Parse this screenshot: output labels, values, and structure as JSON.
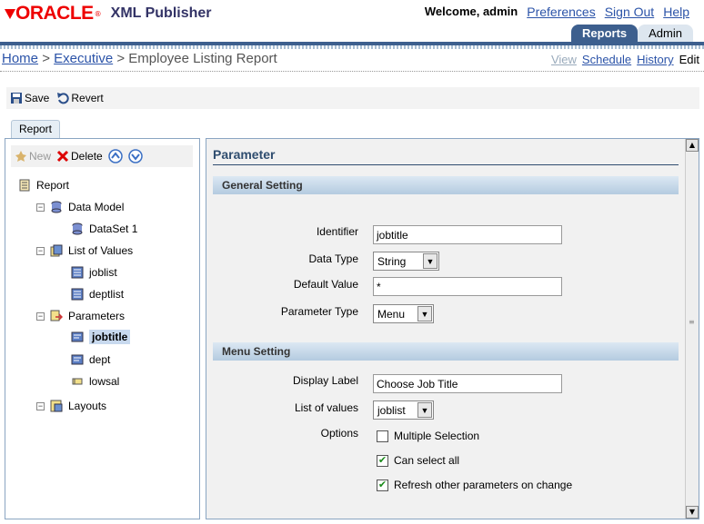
{
  "header": {
    "brand": "ORACLE",
    "product": "XML Publisher",
    "welcome": "Welcome, admin",
    "links": [
      "Preferences",
      "Sign Out",
      "Help"
    ],
    "tabs": [
      "Reports",
      "Admin"
    ]
  },
  "breadcrumb": {
    "items": [
      "Home",
      "Executive"
    ],
    "separator": ">",
    "current": "Employee Listing Report"
  },
  "views": {
    "view": "View",
    "schedule": "Schedule",
    "history": "History",
    "edit": "Edit"
  },
  "toolbar": {
    "save": "Save",
    "revert": "Revert"
  },
  "left": {
    "tab": "Report",
    "new": "New",
    "delete": "Delete",
    "tree": {
      "root": "Report",
      "data_model": "Data Model",
      "dataset": "DataSet 1",
      "lov": "List of Values",
      "lov_items": [
        "joblist",
        "deptlist"
      ],
      "parameters": "Parameters",
      "param_items": [
        "jobtitle",
        "dept",
        "lowsal"
      ],
      "layouts": "Layouts"
    }
  },
  "panel": {
    "title": "Parameter",
    "general": "General Setting",
    "identifier_label": "Identifier",
    "identifier_value": "jobtitle",
    "datatype_label": "Data Type",
    "datatype_value": "String",
    "default_label": "Default Value",
    "default_value": "*",
    "paramtype_label": "Parameter Type",
    "paramtype_value": "Menu",
    "menu": "Menu Setting",
    "display_label": "Display Label",
    "display_value": "Choose Job Title",
    "lov_label": "List of values",
    "lov_value": "joblist",
    "options_label": "Options",
    "opt_multi": "Multiple Selection",
    "opt_all": "Can select all",
    "opt_refresh": "Refresh other parameters on change"
  },
  "colors": {
    "brand": "#e00000",
    "accent": "#3d5f8e",
    "link": "#2b53a8"
  }
}
